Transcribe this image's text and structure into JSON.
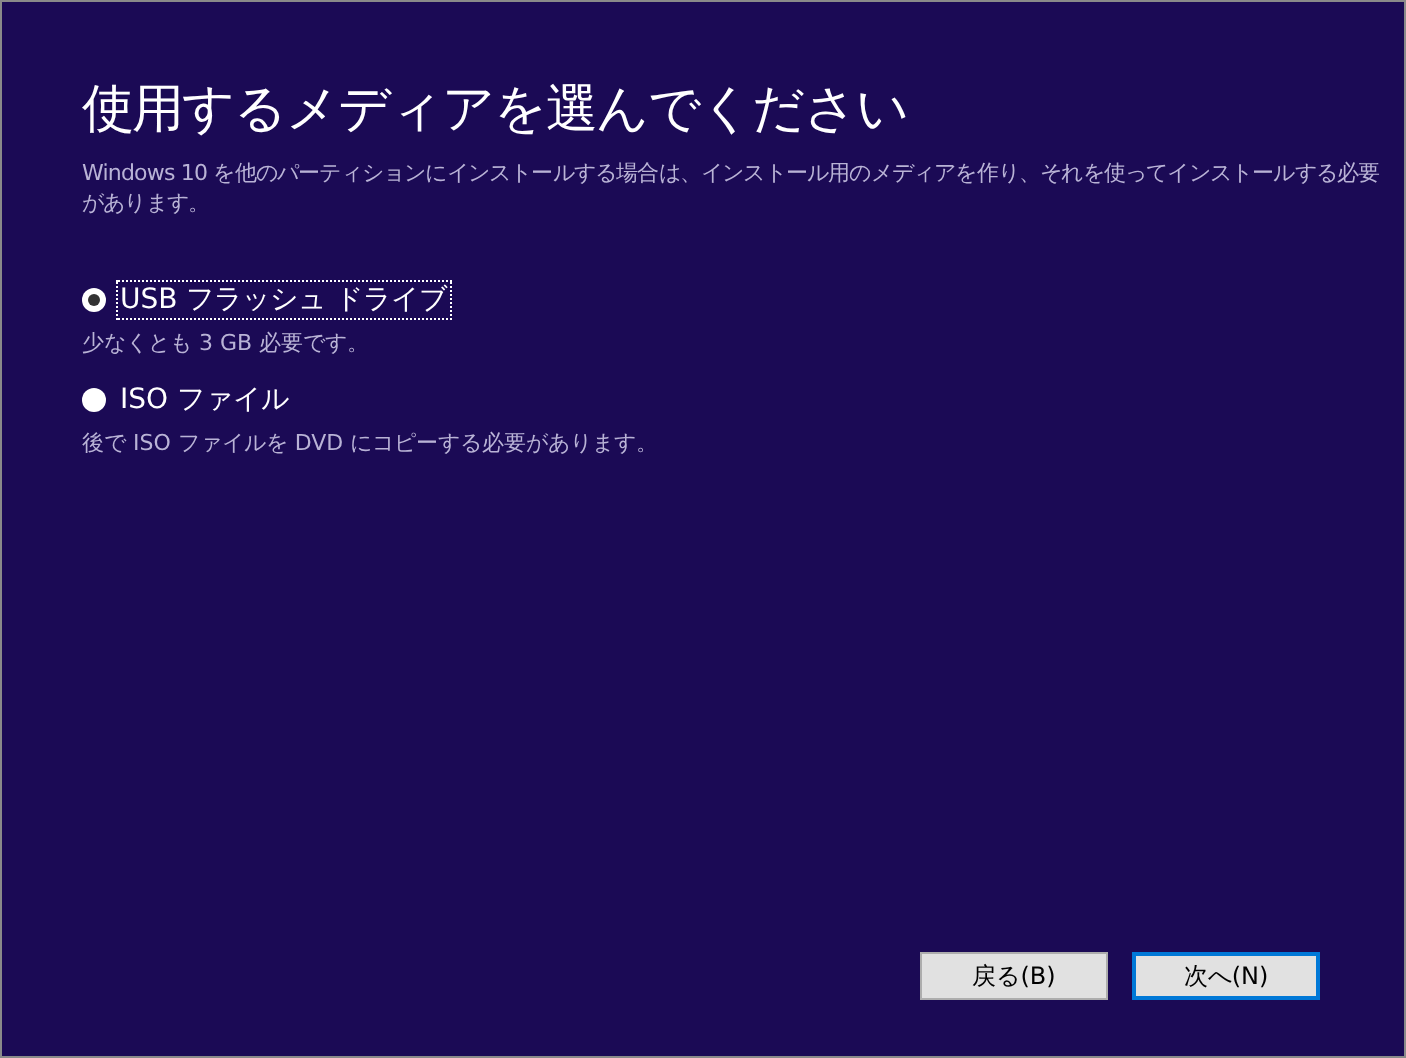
{
  "title": "使用するメディアを選んでください",
  "description": "Windows 10 を他のパーティションにインストールする場合は、インストール用のメディアを作り、それを使ってインストールする必要があります。",
  "options": [
    {
      "label": "USB フラッシュ ドライブ",
      "note": "少なくとも 3 GB 必要です。",
      "selected": true
    },
    {
      "label": "ISO ファイル",
      "note": "後で ISO ファイルを DVD にコピーする必要があります。",
      "selected": false
    }
  ],
  "buttons": [
    {
      "label": "戻る(B)",
      "default": false
    },
    {
      "label": "次へ(N)",
      "default": true
    }
  ]
}
